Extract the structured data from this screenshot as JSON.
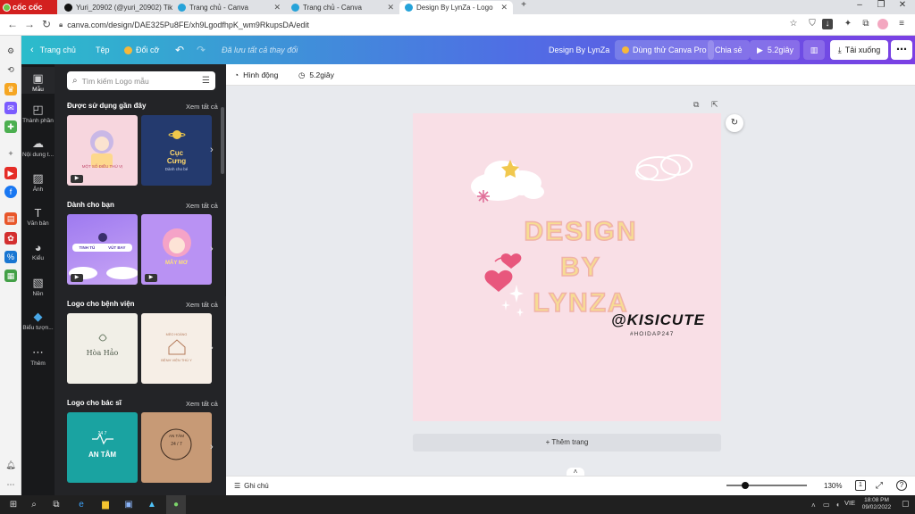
{
  "browser": {
    "brand": "cốc cốc",
    "tabs": [
      {
        "label": "Yuri_20902 (@yuri_20902) Tik",
        "color": "#111111"
      },
      {
        "label": "Trang chủ - Canva",
        "color": "#26a3d9"
      },
      {
        "label": "Trang chủ - Canva",
        "color": "#26a3d9"
      },
      {
        "label": "Design By LynZa - Logo",
        "color": "#26a3d9"
      }
    ],
    "url": "canva.com/design/DAE325Pu8FE/xh9LgodfhpK_wm9RkupsDA/edit"
  },
  "header": {
    "home": "Trang chủ",
    "file": "Tệp",
    "resize": "Đổi cỡ",
    "saved": "Đã lưu tất cả thay đổi",
    "design_name": "Design By LynZa",
    "try_pro": "Dùng thử Canva Pro",
    "share": "Chia sẻ",
    "play": "5.2giây",
    "download": "Tải xuống"
  },
  "rail": [
    {
      "label": "Mẫu",
      "icon": "layout-icon"
    },
    {
      "label": "Thành phần",
      "icon": "shapes-icon"
    },
    {
      "label": "Nội dung t...",
      "icon": "upload-icon"
    },
    {
      "label": "Ảnh",
      "icon": "image-icon"
    },
    {
      "label": "Văn bản",
      "icon": "text-icon"
    },
    {
      "label": "Kiểu",
      "icon": "palette-icon"
    },
    {
      "label": "Nền",
      "icon": "background-icon"
    },
    {
      "label": "Biểu tượn...",
      "icon": "logo-icon"
    },
    {
      "label": "Thêm",
      "icon": "more-icon"
    }
  ],
  "panel": {
    "search_placeholder": "Tìm kiếm Logo mẫu",
    "see_all": "Xem tất cả",
    "sections": [
      {
        "title": "Được sử dụng gần đây"
      },
      {
        "title": "Dành cho bạn"
      },
      {
        "title": "Logo cho bệnh viện"
      },
      {
        "title": "Logo cho bác sĩ"
      }
    ],
    "thumb_text": {
      "t1": "MỘT SỐ ĐIỀU THÚ VỊ",
      "t2a": "Cục",
      "t2b": "Cưng",
      "t2c": "Dành cho bé",
      "t3": "TINH TÚ",
      "t3b": "VÚT BAY",
      "t4": "MÂY MƠ",
      "t5": "Hòa Hảo",
      "t6a": "MÈO HOÀNG",
      "t6b": "BỆNH VIỆN THÚ Y",
      "t7a": "24  7",
      "t7b": "AN TÂM",
      "t8a": "AN TÂM",
      "t8b": "24 / 7"
    }
  },
  "editor": {
    "animate": "Hình động",
    "duration": "5.2giây",
    "add_page": "+ Thêm trang",
    "notes": "Ghi chú",
    "zoom": "130%",
    "page_num": "1"
  },
  "design": {
    "line1": "DESIGN BY",
    "line2": "LYNZA",
    "handle": "@KISICUTE",
    "tag": "#HOIDAP247"
  },
  "taskbar": {
    "lang": "VIE",
    "time": "18:08 PM",
    "date": "09/02/2022"
  }
}
